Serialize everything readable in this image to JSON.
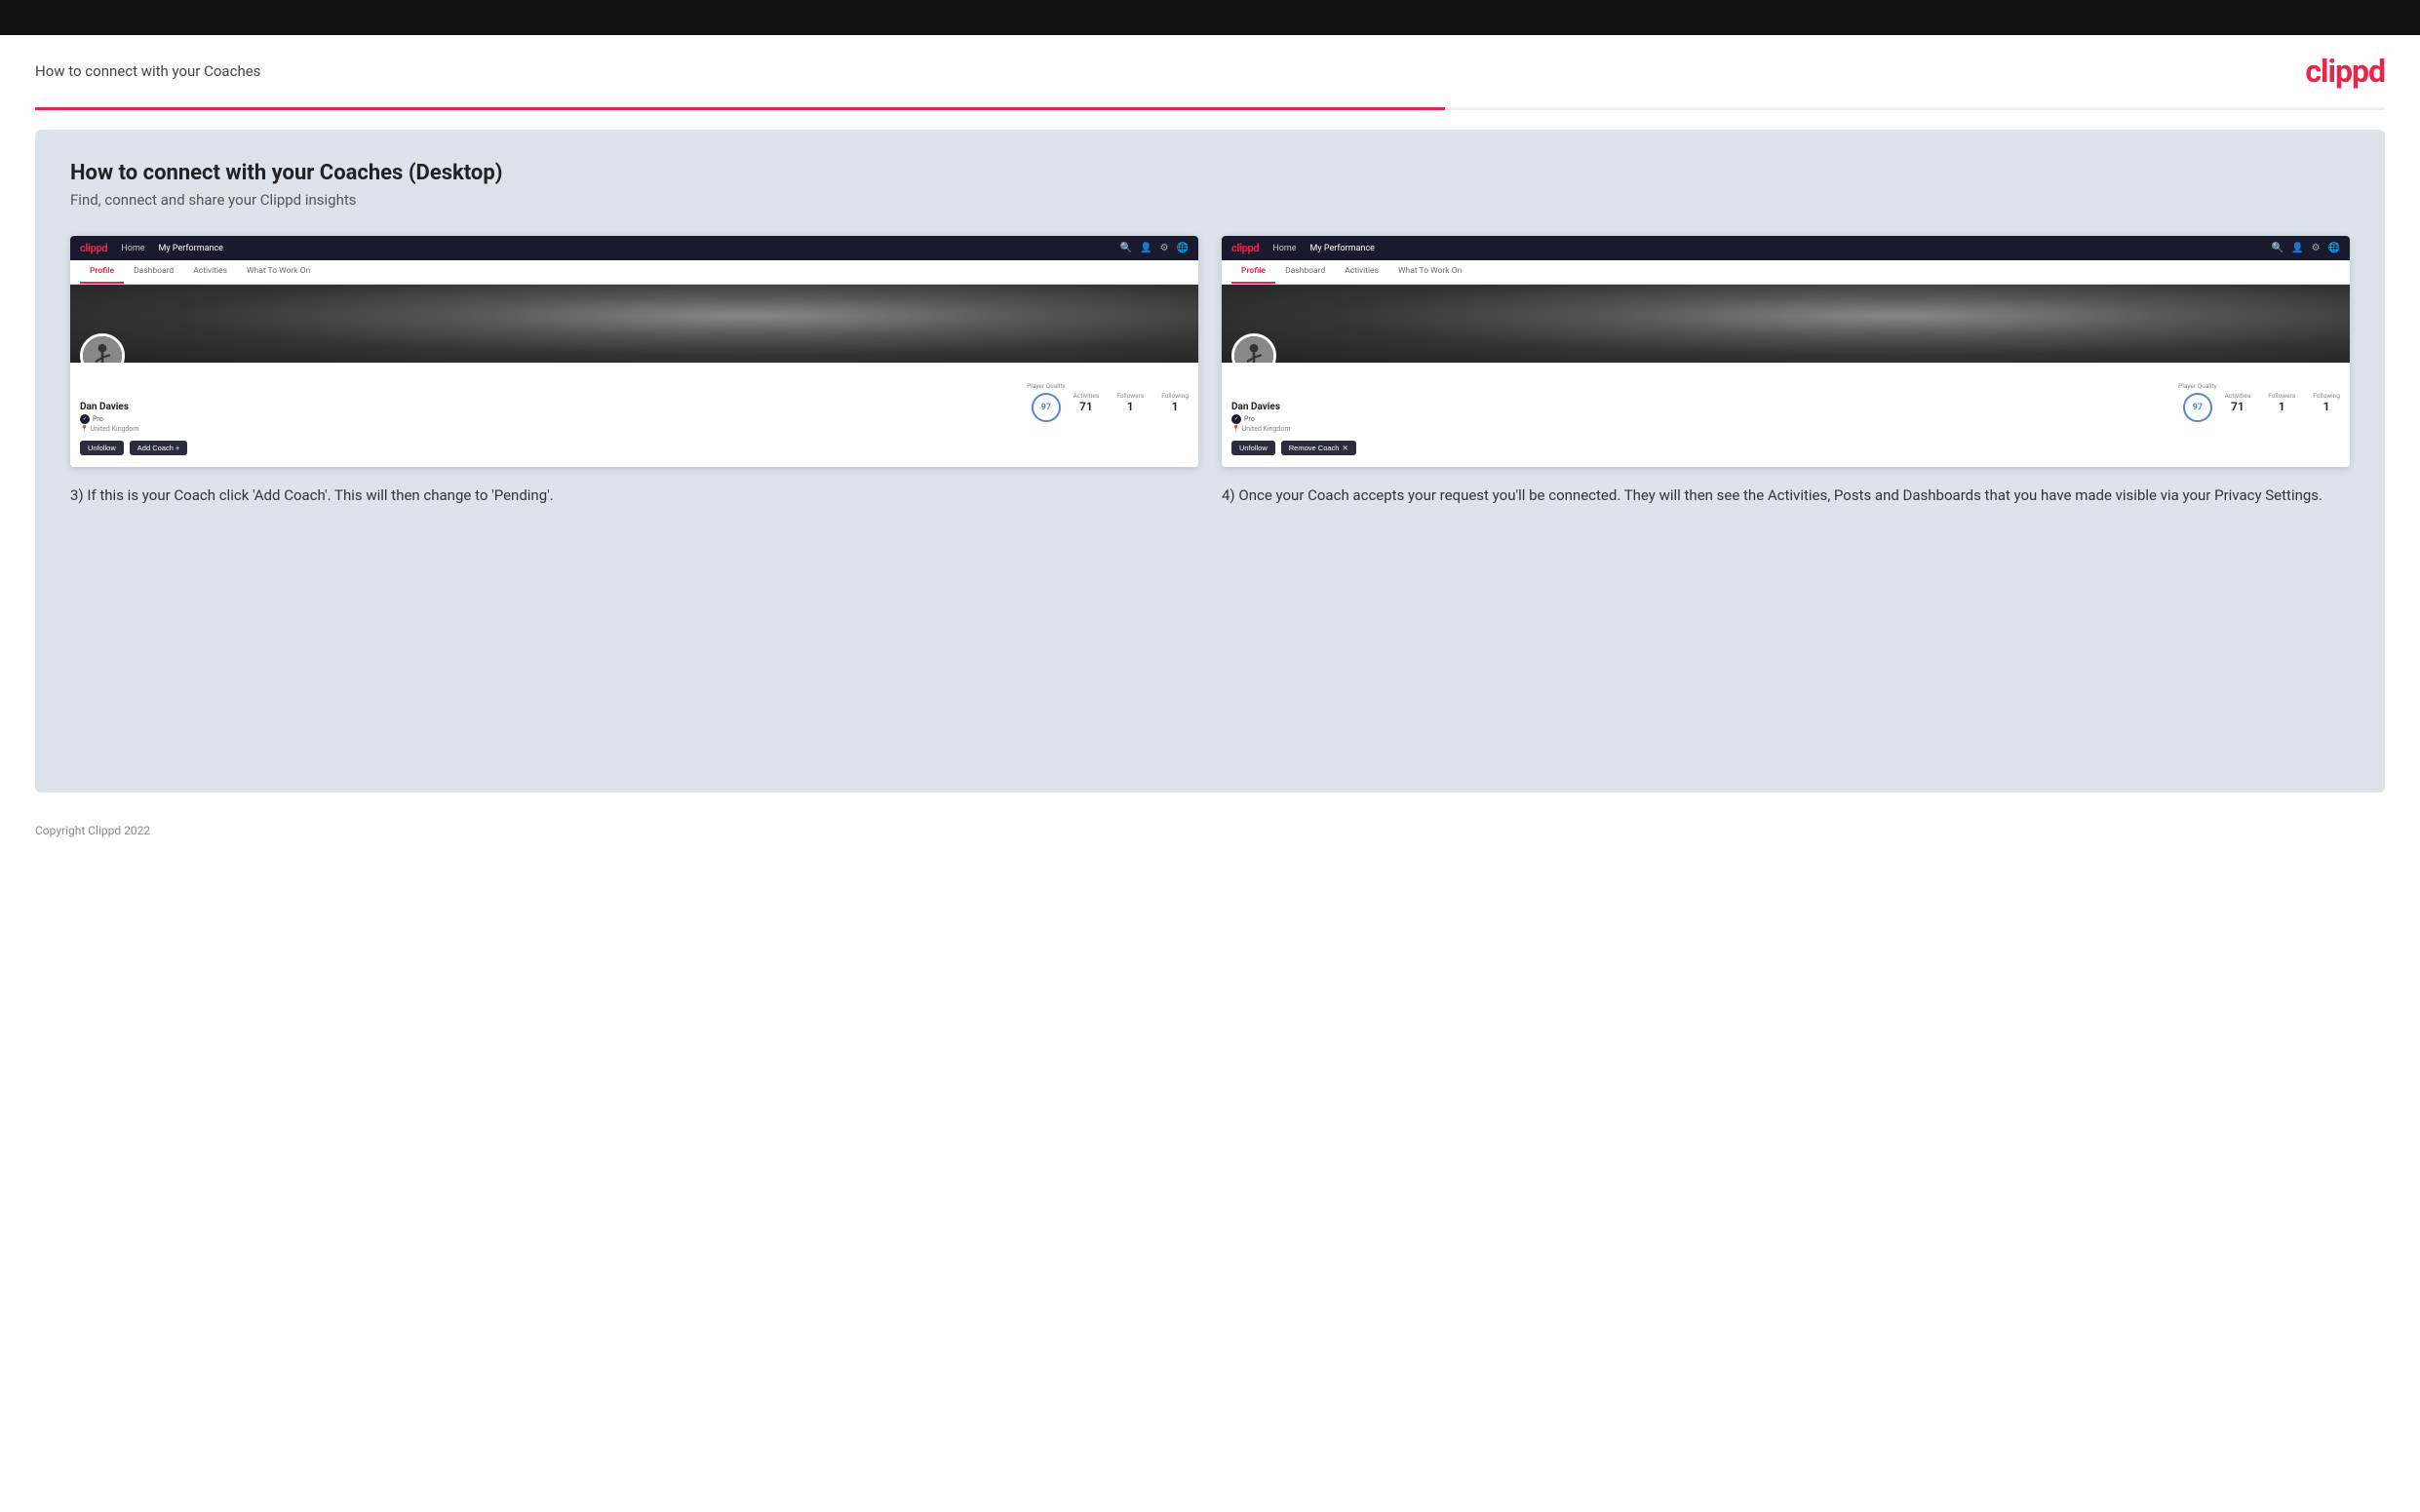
{
  "page": {
    "top_bar": "",
    "header": {
      "title": "How to connect with your Coaches",
      "logo": "clippd"
    },
    "section": {
      "title": "How to connect with your Coaches (Desktop)",
      "subtitle": "Find, connect and share your Clippd insights"
    },
    "left_panel": {
      "nav": {
        "logo": "clippd",
        "items": [
          "Home",
          "My Performance"
        ],
        "icons": [
          "search",
          "person",
          "settings",
          "globe"
        ]
      },
      "tabs": [
        "Profile",
        "Dashboard",
        "Activities",
        "What To Work On"
      ],
      "active_tab": "Profile",
      "player": {
        "name": "Dan Davies",
        "badge": "Pro",
        "location": "United Kingdom",
        "player_quality_label": "Player Quality",
        "player_quality_value": "97",
        "stats": [
          {
            "label": "Activities",
            "value": "71"
          },
          {
            "label": "Followers",
            "value": "1"
          },
          {
            "label": "Following",
            "value": "1"
          }
        ]
      },
      "buttons": [
        "Unfollow",
        "Add Coach"
      ],
      "add_coach_plus": "+",
      "description": "3) If this is your Coach click 'Add Coach'. This will then change to 'Pending'."
    },
    "right_panel": {
      "nav": {
        "logo": "clippd",
        "items": [
          "Home",
          "My Performance"
        ],
        "icons": [
          "search",
          "person",
          "settings",
          "globe"
        ]
      },
      "tabs": [
        "Profile",
        "Dashboard",
        "Activities",
        "What To Work On"
      ],
      "active_tab": "Profile",
      "player": {
        "name": "Dan Davies",
        "badge": "Pro",
        "location": "United Kingdom",
        "player_quality_label": "Player Quality",
        "player_quality_value": "97",
        "stats": [
          {
            "label": "Activities",
            "value": "71"
          },
          {
            "label": "Followers",
            "value": "1"
          },
          {
            "label": "Following",
            "value": "1"
          }
        ]
      },
      "buttons": [
        "Unfollow",
        "Remove Coach"
      ],
      "remove_coach_x": "✕",
      "description": "4) Once your Coach accepts your request you'll be connected. They will then see the Activities, Posts and Dashboards that you have made visible via your Privacy Settings."
    },
    "footer": {
      "copyright": "Copyright Clippd 2022"
    }
  }
}
